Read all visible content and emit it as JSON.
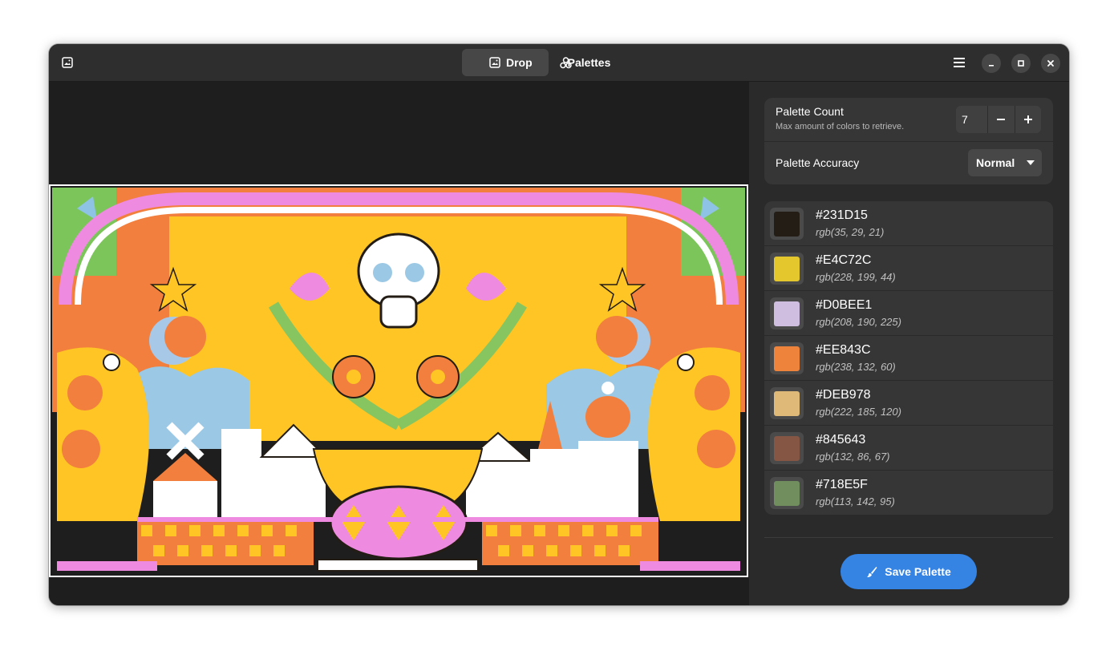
{
  "header": {
    "tabs": [
      {
        "label": "Drop",
        "icon": "image-icon",
        "active": true
      },
      {
        "label": "Palettes",
        "icon": "palette-icon",
        "active": false
      }
    ]
  },
  "settings": {
    "palette_count": {
      "title": "Palette Count",
      "subtitle": "Max amount of colors to retrieve.",
      "value": "7"
    },
    "palette_accuracy": {
      "title": "Palette Accuracy",
      "value": "Normal"
    }
  },
  "colors": [
    {
      "hex": "#231D15",
      "rgb": "rgb(35, 29, 21)"
    },
    {
      "hex": "#E4C72C",
      "rgb": "rgb(228, 199, 44)"
    },
    {
      "hex": "#D0BEE1",
      "rgb": "rgb(208, 190, 225)"
    },
    {
      "hex": "#EE843C",
      "rgb": "rgb(238, 132, 60)"
    },
    {
      "hex": "#DEB978",
      "rgb": "rgb(222, 185, 120)"
    },
    {
      "hex": "#845643",
      "rgb": "rgb(132, 86, 67)"
    },
    {
      "hex": "#718E5F",
      "rgb": "rgb(113, 142, 95)"
    }
  ],
  "actions": {
    "save_label": "Save Palette"
  },
  "theme": {
    "accent": "#3584e4",
    "window_bg": "#242424",
    "headerbar_bg": "#2e2e2e"
  }
}
